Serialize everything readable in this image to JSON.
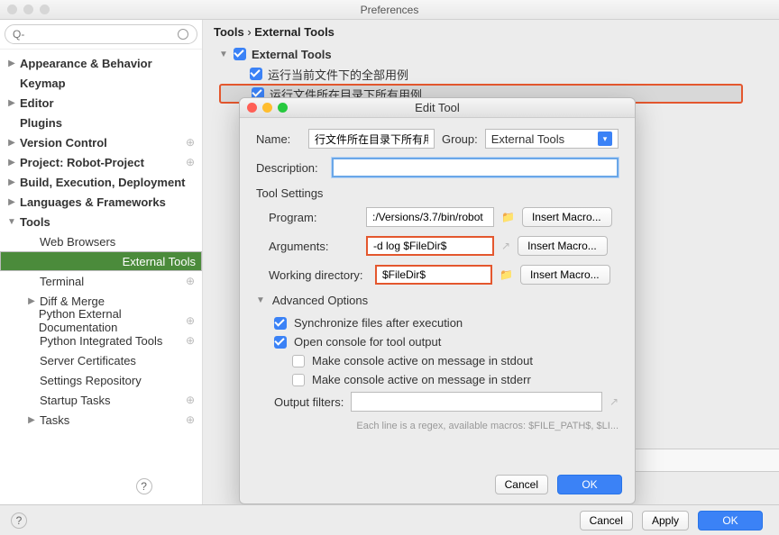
{
  "window": {
    "title": "Preferences"
  },
  "search": {
    "placeholder": "Q-"
  },
  "sidebar": {
    "items": [
      {
        "label": "Appearance & Behavior",
        "bold": true,
        "tri": "▶"
      },
      {
        "label": "Keymap",
        "bold": true,
        "tri": ""
      },
      {
        "label": "Editor",
        "bold": true,
        "tri": "▶"
      },
      {
        "label": "Plugins",
        "bold": true,
        "tri": ""
      },
      {
        "label": "Version Control",
        "bold": true,
        "tri": "▶",
        "gear": true
      },
      {
        "label": "Project: Robot-Project",
        "bold": true,
        "tri": "▶",
        "gear": true
      },
      {
        "label": "Build, Execution, Deployment",
        "bold": true,
        "tri": "▶"
      },
      {
        "label": "Languages & Frameworks",
        "bold": true,
        "tri": "▶"
      },
      {
        "label": "Tools",
        "bold": true,
        "tri": "▼"
      },
      {
        "label": "Web Browsers",
        "child": true
      },
      {
        "label": "External Tools",
        "child": true,
        "sel": true
      },
      {
        "label": "Terminal",
        "child": true,
        "gear": true
      },
      {
        "label": "Diff & Merge",
        "child": true,
        "tri": "▶"
      },
      {
        "label": "Python External Documentation",
        "child": true,
        "gear": true
      },
      {
        "label": "Python Integrated Tools",
        "child": true,
        "gear": true
      },
      {
        "label": "Server Certificates",
        "child": true
      },
      {
        "label": "Settings Repository",
        "child": true
      },
      {
        "label": "Startup Tasks",
        "child": true,
        "gear": true
      },
      {
        "label": "Tasks",
        "child": true,
        "tri": "▶",
        "gear": true
      }
    ]
  },
  "breadcrumb": {
    "a": "Tools",
    "sep": "›",
    "b": "External Tools"
  },
  "ext_tools": {
    "root": "External Tools",
    "items": [
      {
        "label": "运行当前文件下的全部用例"
      },
      {
        "label": "运行文件所在目录下所有用例",
        "sel": true
      }
    ]
  },
  "dialog": {
    "title": "Edit Tool",
    "name_label": "Name:",
    "name_value": "行文件所在目录下所有用例",
    "group_label": "Group:",
    "group_value": "External Tools",
    "desc_label": "Description:",
    "desc_value": "",
    "tool_settings": "Tool Settings",
    "program_label": "Program:",
    "program_value": ":/Versions/3.7/bin/robot",
    "arguments_label": "Arguments:",
    "arguments_value": "-d log $FileDir$",
    "wd_label": "Working directory:",
    "wd_value": "$FileDir$",
    "insert_macro": "Insert Macro...",
    "adv": "Advanced Options",
    "opt_sync": "Synchronize files after execution",
    "opt_console": "Open console for tool output",
    "opt_stdout": "Make console active on message in stdout",
    "opt_stderr": "Make console active on message in stderr",
    "output_filters": "Output filters:",
    "hint": "Each line is a regex, available macros: $FILE_PATH$, $LI...",
    "cancel": "Cancel",
    "ok": "OK"
  },
  "footer": {
    "cancel": "Cancel",
    "apply": "Apply",
    "ok": "OK"
  }
}
